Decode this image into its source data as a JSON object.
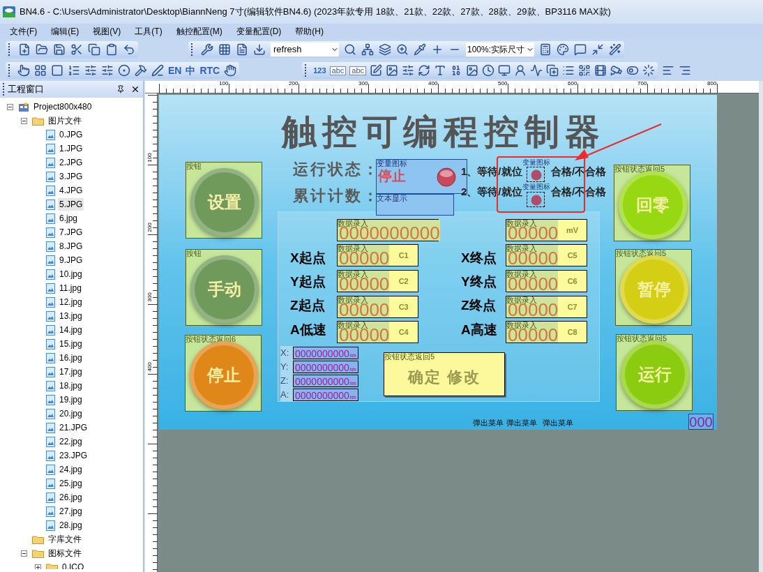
{
  "window": {
    "title": "BN4.6 - C:\\Users\\Administrator\\Desktop\\BiannNeng 7寸(编辑软件BN4.6) (2023年款专用 18款、21款、22款、27款、28款、29款、BP3116 MAX款)"
  },
  "menu": [
    "文件(F)",
    "编辑(E)",
    "视图(V)",
    "工具(T)",
    "触控配置(M)",
    "变量配置(D)",
    "帮助(H)"
  ],
  "toolbar": {
    "command_value": "refresh",
    "zoom_value": "100%:实际尺寸",
    "text_tools": [
      "EN",
      "中",
      "RTC"
    ],
    "widget_text_tools": [
      "123",
      "abc",
      "abc"
    ]
  },
  "project_panel": {
    "title": "工程窗口",
    "tree": [
      {
        "label": "Project800x480",
        "kind": "project",
        "expanded": true,
        "selected": false,
        "children": [
          {
            "label": "图片文件",
            "kind": "folder",
            "expanded": true,
            "selected": false,
            "children": [
              {
                "label": "0.JPG",
                "kind": "file",
                "selected": false
              },
              {
                "label": "1.JPG",
                "kind": "file",
                "selected": false
              },
              {
                "label": "2.JPG",
                "kind": "file",
                "selected": false
              },
              {
                "label": "3.JPG",
                "kind": "file",
                "selected": false
              },
              {
                "label": "4.JPG",
                "kind": "file",
                "selected": false
              },
              {
                "label": "5.JPG",
                "kind": "file",
                "selected": true
              },
              {
                "label": "6.jpg",
                "kind": "file",
                "selected": false
              },
              {
                "label": "7.JPG",
                "kind": "file",
                "selected": false
              },
              {
                "label": "8.JPG",
                "kind": "file",
                "selected": false
              },
              {
                "label": "9.JPG",
                "kind": "file",
                "selected": false
              },
              {
                "label": "10.jpg",
                "kind": "file",
                "selected": false
              },
              {
                "label": "11.jpg",
                "kind": "file",
                "selected": false
              },
              {
                "label": "12.jpg",
                "kind": "file",
                "selected": false
              },
              {
                "label": "13.jpg",
                "kind": "file",
                "selected": false
              },
              {
                "label": "14.jpg",
                "kind": "file",
                "selected": false
              },
              {
                "label": "15.jpg",
                "kind": "file",
                "selected": false
              },
              {
                "label": "16.jpg",
                "kind": "file",
                "selected": false
              },
              {
                "label": "17.jpg",
                "kind": "file",
                "selected": false
              },
              {
                "label": "18.jpg",
                "kind": "file",
                "selected": false
              },
              {
                "label": "19.jpg",
                "kind": "file",
                "selected": false
              },
              {
                "label": "20.jpg",
                "kind": "file",
                "selected": false
              },
              {
                "label": "21.JPG",
                "kind": "file",
                "selected": false
              },
              {
                "label": "22.jpg",
                "kind": "file",
                "selected": false
              },
              {
                "label": "23.JPG",
                "kind": "file",
                "selected": false
              },
              {
                "label": "24.jpg",
                "kind": "file",
                "selected": false
              },
              {
                "label": "25.jpg",
                "kind": "file",
                "selected": false
              },
              {
                "label": "26.jpg",
                "kind": "file",
                "selected": false
              },
              {
                "label": "27.jpg",
                "kind": "file",
                "selected": false
              },
              {
                "label": "28.jpg",
                "kind": "file",
                "selected": false
              }
            ]
          },
          {
            "label": "字库文件",
            "kind": "folder",
            "selected": false
          },
          {
            "label": "图标文件",
            "kind": "folder",
            "expanded": true,
            "selected": false,
            "children": [
              {
                "label": "0.ICO",
                "kind": "folder",
                "expanded": false,
                "selected": false
              }
            ]
          }
        ]
      }
    ]
  },
  "ruler": {
    "x_labels": [
      "100",
      "200",
      "300",
      "400",
      "500",
      "600",
      "700",
      "800"
    ],
    "y_labels": [
      "100",
      "200",
      "300",
      "400"
    ]
  },
  "screen": {
    "title": "触控可编程控制器",
    "status": {
      "label": "运行状态：",
      "tag": "变量图标",
      "value": "停止"
    },
    "counter": {
      "label": "累计计数：",
      "tag": "文本显示"
    },
    "checks": [
      {
        "index": "1、等待/就位",
        "tag": "变量图标",
        "result": "合格/不合格"
      },
      {
        "index": "2、等待/就位",
        "tag": "变量图标",
        "result": "合格/不合格"
      }
    ],
    "buttons": [
      {
        "tag": "按钮",
        "label": "设置",
        "color": "#6f9a5c"
      },
      {
        "tag": "按钮",
        "label": "手动",
        "color": "#6f9a5c"
      },
      {
        "tag": "按钮状态返回6",
        "label": "停止",
        "color": "#e0871a"
      },
      {
        "tag": "按钮状态返回5",
        "label": "回零",
        "color": "#98d812"
      },
      {
        "tag": "按钮状态返回5",
        "label": "暂停",
        "color": "#d4cf14"
      },
      {
        "tag": "按钮状态返回5",
        "label": "运行",
        "color": "#8ccc10"
      }
    ],
    "left_fields": [
      {
        "tag": "数据录入",
        "value": "0000000000"
      },
      {
        "label": "X起点",
        "tag": "数据录入",
        "value": "00000",
        "unit": "C1"
      },
      {
        "label": "Y起点",
        "tag": "数据录入",
        "value": "00000",
        "unit": "C2"
      },
      {
        "label": "Z起点",
        "tag": "数据录入",
        "value": "00000",
        "unit": "C3"
      },
      {
        "label": "A低速",
        "tag": "数据录入",
        "value": "00000",
        "unit": "C4"
      }
    ],
    "right_fields": [
      {
        "tag": "数据录入",
        "value": "00000",
        "unit": "mV"
      },
      {
        "label": "X终点",
        "tag": "数据录入",
        "value": "00000",
        "unit": "C5"
      },
      {
        "label": "Y终点",
        "tag": "数据录入",
        "value": "00000",
        "unit": "C6"
      },
      {
        "label": "Z终点",
        "tag": "数据录入",
        "value": "00000",
        "unit": "C7"
      },
      {
        "label": "A高速",
        "tag": "数据录入",
        "value": "00000",
        "unit": "C8"
      }
    ],
    "coordinates": [
      {
        "axis": "X:",
        "value": "0000000000",
        "unit": "㎜"
      },
      {
        "axis": "Y:",
        "value": "0000000000",
        "unit": "㎜"
      },
      {
        "axis": "Z:",
        "value": "0000000000",
        "unit": "㎜"
      },
      {
        "axis": "A:",
        "value": "0000000000",
        "unit": "㎜"
      }
    ],
    "confirm": {
      "tag": "按钮状态返回5",
      "label": "确定 修改"
    },
    "popups": [
      "弹出菜单",
      "弹出菜单",
      "弹出菜单"
    ],
    "counter_display": "000"
  }
}
